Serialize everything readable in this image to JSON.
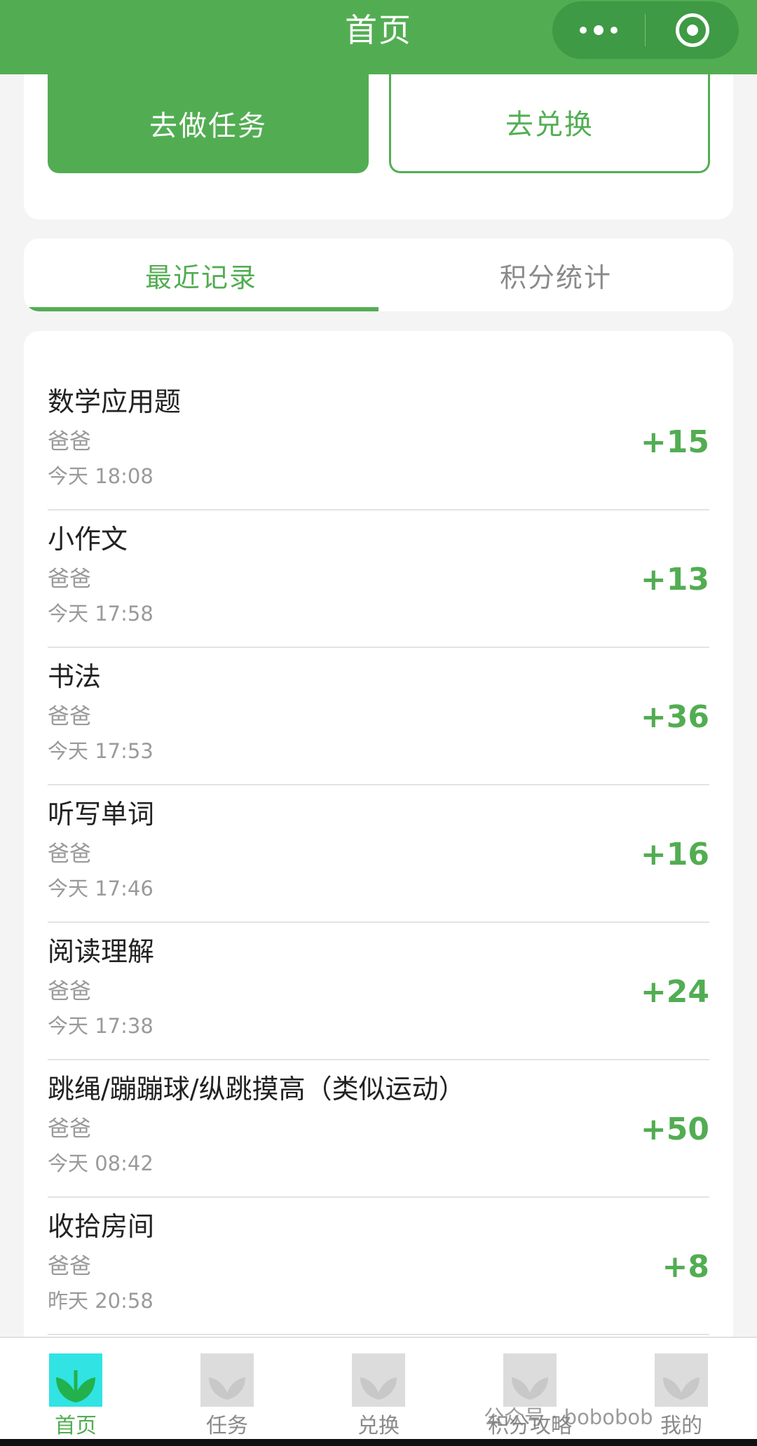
{
  "header": {
    "title": "首页"
  },
  "actions": {
    "task_label": "去做任务",
    "exchange_label": "去兑换"
  },
  "tabs": [
    {
      "label": "最近记录",
      "active": true
    },
    {
      "label": "积分统计",
      "active": false
    }
  ],
  "records": [
    {
      "name": "数学应用题",
      "giver": "爸爸",
      "time": "今天 18:08",
      "points": "+15"
    },
    {
      "name": "小作文",
      "giver": "爸爸",
      "time": "今天 17:58",
      "points": "+13"
    },
    {
      "name": "书法",
      "giver": "爸爸",
      "time": "今天 17:53",
      "points": "+36"
    },
    {
      "name": "听写单词",
      "giver": "爸爸",
      "time": "今天 17:46",
      "points": "+16"
    },
    {
      "name": "阅读理解",
      "giver": "爸爸",
      "time": "今天 17:38",
      "points": "+24"
    },
    {
      "name": "跳绳/蹦蹦球/纵跳摸高（类似运动）",
      "giver": "爸爸",
      "time": "今天 08:42",
      "points": "+50"
    },
    {
      "name": "收拾房间",
      "giver": "爸爸",
      "time": "昨天 20:58",
      "points": "+8"
    }
  ],
  "tabbar": [
    {
      "label": "首页",
      "icon": "home-icon",
      "active": true
    },
    {
      "label": "任务",
      "icon": "task-icon",
      "active": false
    },
    {
      "label": "兑换",
      "icon": "exchange-icon",
      "active": false
    },
    {
      "label": "积分攻略",
      "icon": "strategy-icon",
      "active": false
    },
    {
      "label": "我的",
      "icon": "profile-icon",
      "active": false
    }
  ],
  "watermark": "公众号 · bobobob",
  "colors": {
    "brand": "#52ad52",
    "brand_dark": "#3e9a44",
    "active_icon_bg": "#31e3e3"
  }
}
